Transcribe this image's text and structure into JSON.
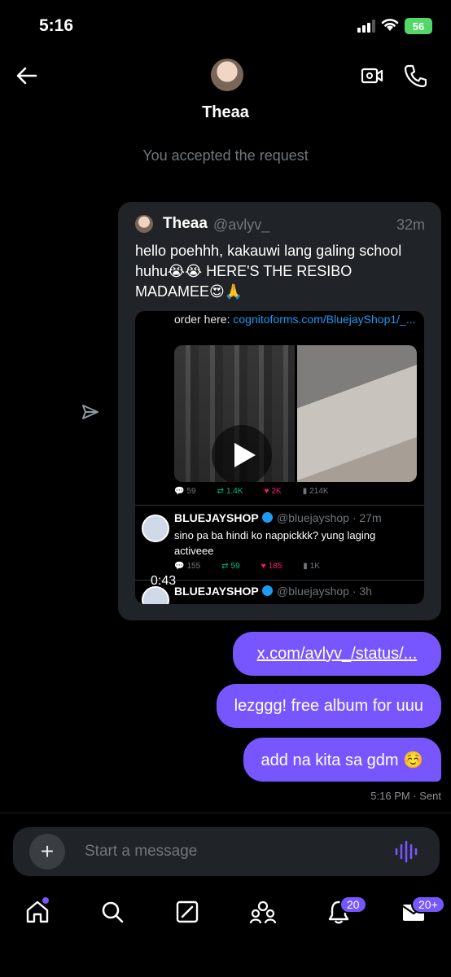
{
  "status_bar": {
    "time": "5:16",
    "battery": "56"
  },
  "header": {
    "contact_name": "Theaa",
    "avatar_icon": "profile-photo",
    "video_icon": "video-call-icon",
    "phone_icon": "phone-icon"
  },
  "system_message": "You accepted the request",
  "tweet": {
    "author": "Theaa",
    "handle": "@avlyv_",
    "time": "32m",
    "text": "hello poehhh, kakauwi lang galing school huhu😭😭 HERE'S THE RESIBO MADAMEE😍🙏",
    "embed": {
      "order_prefix": "order here: ",
      "order_link": "cognitoforms.com/BluejayShop1/_...",
      "stats1": {
        "replies": "59",
        "reposts": "1.4K",
        "likes": "2K",
        "views": "214K"
      },
      "post2": {
        "name": "BLUEJAYSHOP",
        "handle": "@bluejayshop · 27m",
        "text": "sino pa ba hindi ko nappickkk? yung laging activeee"
      },
      "stats2": {
        "replies": "155",
        "reposts": "59",
        "likes": "185",
        "views": "1K"
      },
      "post3": {
        "name": "BLUEJAYSHOP",
        "handle": "@bluejayshop · 3h"
      },
      "video_duration": "0:43"
    }
  },
  "messages": [
    {
      "text": "x.com/avlyv_/status/..."
    },
    {
      "text": "lezggg! free album for uuu"
    },
    {
      "text": "add na kita sa gdm ☺️"
    }
  ],
  "message_meta": "5:16 PM · Sent",
  "composer": {
    "placeholder": "Start a message"
  },
  "tabbar": {
    "notifications_badge": "20",
    "messages_badge": "20+"
  },
  "colors": {
    "accent": "#7856ff",
    "background": "#000000",
    "card": "#202327"
  }
}
